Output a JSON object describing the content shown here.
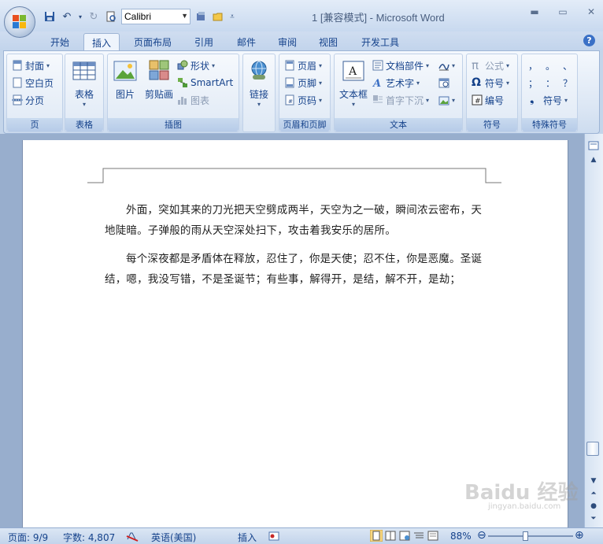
{
  "title_bar": {
    "doc_title": "1 [兼容模式] - Microsoft Word",
    "font_name": "Calibri"
  },
  "tabs": [
    "开始",
    "插入",
    "页面布局",
    "引用",
    "邮件",
    "审阅",
    "视图",
    "开发工具"
  ],
  "active_tab": "插入",
  "ribbon": {
    "page_group": {
      "label": "页",
      "items": [
        "封面",
        "空白页",
        "分页"
      ]
    },
    "table_group": {
      "label": "表格",
      "button": "表格"
    },
    "illustrations_group": {
      "label": "插图",
      "picture": "图片",
      "clipart": "剪贴画",
      "shapes": "形状",
      "smartart": "SmartArt",
      "chart": "图表"
    },
    "links_group": {
      "button": "链接"
    },
    "header_footer_group": {
      "label": "页眉和页脚",
      "items": [
        "页眉",
        "页脚",
        "页码"
      ]
    },
    "text_group": {
      "label": "文本",
      "textbox": "文本框",
      "parts": "文档部件",
      "wordart": "艺术字",
      "dropcap": "首字下沉"
    },
    "symbols_group": {
      "label": "符号",
      "equation": "公式",
      "symbol": "符号",
      "numbering": "编号"
    },
    "special_group": {
      "label": "特殊符号",
      "chars": [
        "，",
        "。",
        "、",
        "；",
        "：",
        "？"
      ],
      "symbol": "符号"
    }
  },
  "document": {
    "paragraphs": [
      "外面，突如其来的刀光把天空劈成两半，天空为之一破，瞬间浓云密布，天地陡暗。子弹般的雨从天空深处扫下，攻击着我安乐的居所。",
      "每个深夜都是矛盾体在释放，忍住了，你是天使；忍不住，你是恶魔。圣诞结，嗯，我没写错，不是圣诞节；有些事，解得开，是结，解不开，是劫；"
    ]
  },
  "status_bar": {
    "page": "页面: 9/9",
    "words": "字数: 4,807",
    "language": "英语(美国)",
    "mode": "插入",
    "zoom": "88%",
    "zoom_level": 0.44
  },
  "watermark": {
    "text": "Baidu 经验",
    "sub": "jingyan.baidu.com"
  },
  "colors": {
    "accent": "#15428b",
    "ribbon_bg": "#dbe6f4",
    "doc_bg": "#98aecd"
  }
}
